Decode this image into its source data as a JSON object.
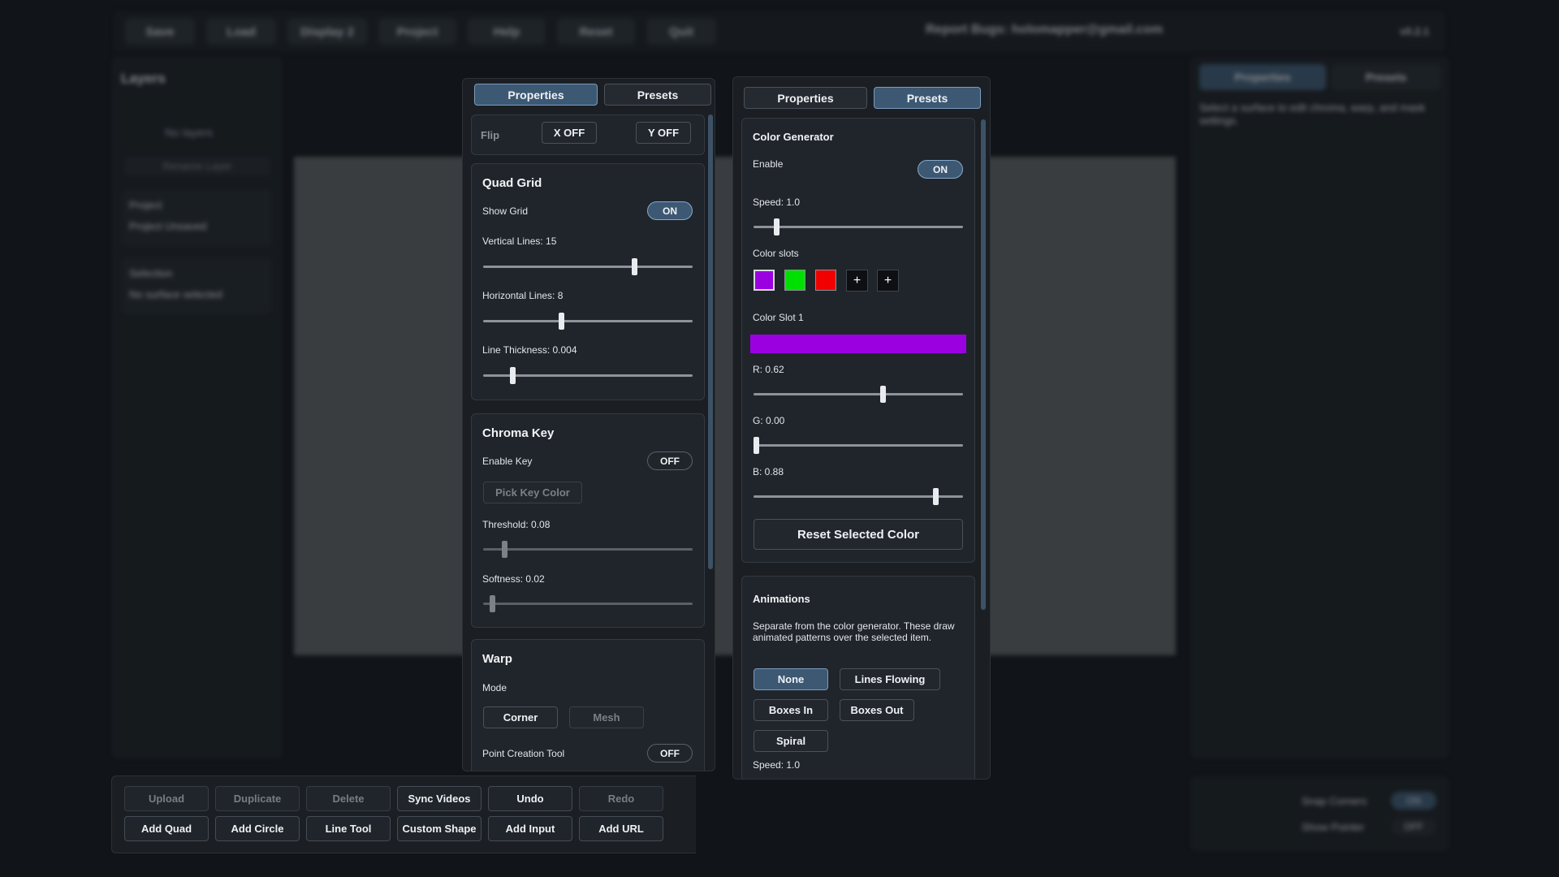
{
  "background": {
    "top_buttons": [
      "Save",
      "Load",
      "Display 2",
      "Project",
      "Help",
      "Reset",
      "Quit"
    ],
    "report": "Report Bugs: holomapper@gmail.com",
    "version": "v0.2.1",
    "layers_title": "Layers",
    "no_layers": "No layers",
    "rename_layer": "Rename Layer",
    "project_label": "Project",
    "project_value": "Project Unsaved",
    "selection_label": "Selection",
    "selection_value": "No surface selected",
    "right_tabs": [
      "Properties",
      "Presets"
    ],
    "right_hint": "Select a surface to edit chroma, warp, and mask settings.",
    "snap_corners": "Snap Corners",
    "snap_corners_state": "ON",
    "show_pointer": "Show Pointer",
    "show_pointer_state": "OFF"
  },
  "left_panel": {
    "tabs": [
      {
        "label": "Properties",
        "active": true
      },
      {
        "label": "Presets",
        "active": false
      }
    ],
    "flip": {
      "label": "Flip",
      "x": "X OFF",
      "y": "Y OFF"
    },
    "quad_grid": {
      "title": "Quad Grid",
      "show_grid_label": "Show Grid",
      "show_grid_state": "ON",
      "vertical_label": "Vertical Lines: 15",
      "vertical_fraction": 0.73,
      "horizontal_label": "Horizontal Lines: 8",
      "horizontal_fraction": 0.37,
      "thickness_label": "Line Thickness: 0.004",
      "thickness_fraction": 0.13
    },
    "chroma_key": {
      "title": "Chroma Key",
      "enable_label": "Enable Key",
      "enable_state": "OFF",
      "pick_label": "Pick Key Color",
      "threshold_label": "Threshold: 0.08",
      "threshold_fraction": 0.09,
      "softness_label": "Softness: 0.02",
      "softness_fraction": 0.03
    },
    "warp": {
      "title": "Warp",
      "mode_label": "Mode",
      "corner_label": "Corner",
      "mesh_label": "Mesh",
      "point_tool_label": "Point Creation Tool",
      "point_tool_state": "OFF"
    }
  },
  "right_panel": {
    "tabs": [
      {
        "label": "Properties",
        "active": false
      },
      {
        "label": "Presets",
        "active": true
      }
    ],
    "color_generator": {
      "title": "Color Generator",
      "enable_label": "Enable",
      "enable_state": "ON",
      "speed_label": "Speed: 1.0",
      "speed_fraction": 0.1,
      "slots_label": "Color slots",
      "slot_colors": [
        "#9b00e0",
        "#00e000",
        "#f00000"
      ],
      "add_symbol": "+",
      "slot_title": "Color Slot 1",
      "selected_color": "#9b00e0",
      "r_label": "R: 0.62",
      "r_value": 0.62,
      "g_label": "G: 0.00",
      "g_value": 0.0,
      "b_label": "B: 0.88",
      "b_value": 0.88,
      "reset_label": "Reset Selected Color"
    },
    "animations": {
      "title": "Animations",
      "description": "Separate from the color generator. These draw animated patterns over the selected item.",
      "options": [
        {
          "label": "None",
          "active": true
        },
        {
          "label": "Lines Flowing",
          "active": false
        },
        {
          "label": "Boxes In",
          "active": false
        },
        {
          "label": "Boxes Out",
          "active": false
        },
        {
          "label": "Spiral",
          "active": false
        }
      ],
      "speed_label": "Speed: 1.0"
    }
  },
  "bottom_toolbar": {
    "row1": [
      {
        "label": "Upload",
        "enabled": false
      },
      {
        "label": "Duplicate",
        "enabled": false
      },
      {
        "label": "Delete",
        "enabled": false
      },
      {
        "label": "Sync Videos",
        "enabled": true
      },
      {
        "label": "Undo",
        "enabled": true
      },
      {
        "label": "Redo",
        "enabled": false
      }
    ],
    "row2": [
      {
        "label": "Add Quad",
        "enabled": true
      },
      {
        "label": "Add Circle",
        "enabled": true
      },
      {
        "label": "Line Tool",
        "enabled": true
      },
      {
        "label": "Custom Shape",
        "enabled": true
      },
      {
        "label": "Add Input",
        "enabled": true
      },
      {
        "label": "Add URL",
        "enabled": true
      }
    ]
  }
}
